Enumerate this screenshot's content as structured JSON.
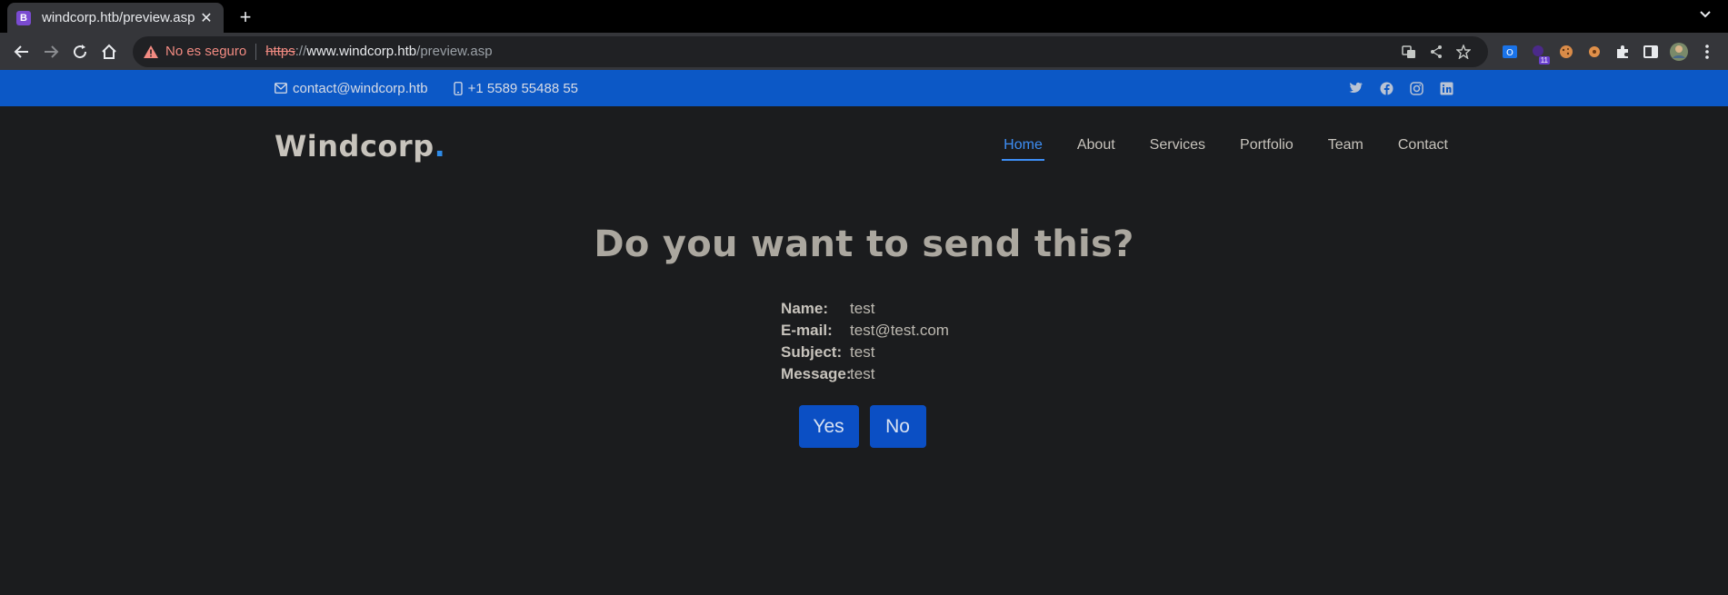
{
  "browser": {
    "tab_title": "windcorp.htb/preview.asp",
    "tab_favicon_letter": "B",
    "security_text": "No es seguro",
    "url_scheme": "https",
    "url_separator": "://",
    "url_host": "www.windcorp.htb",
    "url_path": "/preview.asp",
    "extension_badge": "11"
  },
  "topbar": {
    "email": "contact@windcorp.htb",
    "phone": "+1 5589 55488 55"
  },
  "header": {
    "logo_text": "Windcorp",
    "logo_dot": ".",
    "nav": [
      "Home",
      "About",
      "Services",
      "Portfolio",
      "Team",
      "Contact"
    ]
  },
  "main": {
    "heading": "Do you want to send this?",
    "fields": [
      {
        "label": "Name:",
        "value": "test"
      },
      {
        "label": "E-mail:",
        "value": "test@test.com"
      },
      {
        "label": "Subject:",
        "value": "test"
      },
      {
        "label": "Message:",
        "value": "test"
      }
    ],
    "yes_label": "Yes",
    "no_label": "No"
  },
  "colors": {
    "topbar": "#0c58c6",
    "background": "#1b1c1e",
    "accent": "#3d8ef5",
    "button": "#0b4fc4"
  }
}
